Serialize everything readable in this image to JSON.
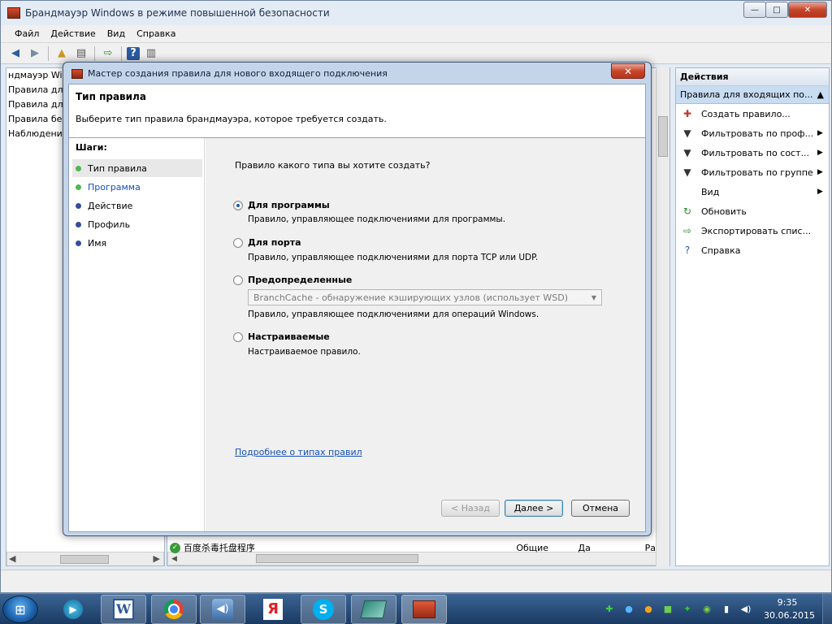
{
  "window": {
    "title": "Брандмауэр Windows в режиме повышенной безопасности",
    "min": "—",
    "max": "□",
    "close": "✕"
  },
  "menu": [
    "Файл",
    "Действие",
    "Вид",
    "Справка"
  ],
  "tree": {
    "items": [
      "ндмауэр Wi",
      "Правила для",
      "Правила для",
      "Правила безо",
      "Наблюдение"
    ]
  },
  "background_row": {
    "name": "百度杀毒托盘程序",
    "profile": "Общие",
    "enabled": "Да",
    "action": "Ра"
  },
  "actions": {
    "header": "Действия",
    "section": "Правила для входящих по...",
    "items": [
      {
        "label": "Создать правило...",
        "icon": "new-rule-icon",
        "submenu": false
      },
      {
        "label": "Фильтровать по проф...",
        "icon": "filter-icon",
        "submenu": true
      },
      {
        "label": "Фильтровать по сост...",
        "icon": "filter-icon",
        "submenu": true
      },
      {
        "label": "Фильтровать по группе",
        "icon": "filter-icon",
        "submenu": true
      },
      {
        "label": "Вид",
        "icon": "",
        "submenu": true
      },
      {
        "label": "Обновить",
        "icon": "refresh-icon",
        "submenu": false
      },
      {
        "label": "Экспортировать спис...",
        "icon": "export-icon",
        "submenu": false
      },
      {
        "label": "Справка",
        "icon": "help-icon",
        "submenu": false
      }
    ]
  },
  "dialog": {
    "title": "Мастер создания правила для нового входящего подключения",
    "close": "✕",
    "heading": "Тип правила",
    "subheading": "Выберите тип правила брандмауэра, которое требуется создать.",
    "steps_title": "Шаги:",
    "steps": [
      {
        "label": "Тип правила",
        "state": "current"
      },
      {
        "label": "Программа",
        "state": "next"
      },
      {
        "label": "Действие",
        "state": "pending"
      },
      {
        "label": "Профиль",
        "state": "pending"
      },
      {
        "label": "Имя",
        "state": "pending"
      }
    ],
    "question": "Правило какого типа вы хотите создать?",
    "options": [
      {
        "title": "Для программы",
        "desc": "Правило, управляющее подключениями для программы.",
        "selected": true
      },
      {
        "title": "Для порта",
        "desc": "Правило, управляющее подключениями для порта TCP или UDP.",
        "selected": false
      },
      {
        "title": "Предопределенные",
        "desc": "Правило, управляющее подключениями для операций Windows.",
        "selected": false
      },
      {
        "title": "Настраиваемые",
        "desc": "Настраиваемое правило.",
        "selected": false
      }
    ],
    "predefined_value": "BranchCache - обнаружение кэширующих узлов (использует WSD)",
    "link": "Подробнее о типах правил",
    "buttons": {
      "back": "< Назад",
      "next": "Далее >",
      "cancel": "Отмена"
    }
  },
  "taskbar": {
    "time": "9:35",
    "date": "30.06.2015",
    "apps": [
      "media-player",
      "word",
      "chrome",
      "sound-app",
      "yandex",
      "skype",
      "network-tool",
      "firewall-app"
    ]
  },
  "colors": {
    "step_done": "#4fb84f",
    "step_pending": "#2f4f9a",
    "link": "#1450b4"
  }
}
